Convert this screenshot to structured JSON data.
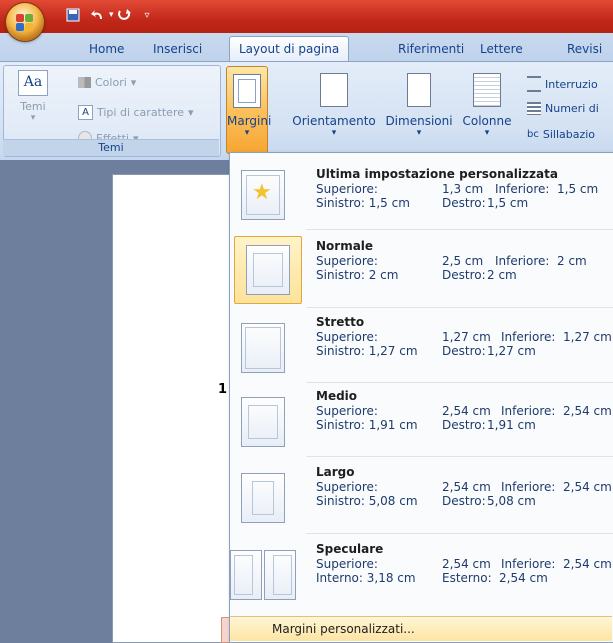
{
  "quick_access": {
    "save_icon": "save-icon",
    "undo_icon": "undo-icon",
    "redo_icon": "redo-icon",
    "customize_icon": "customize-icon"
  },
  "tabs": [
    {
      "label": "Home"
    },
    {
      "label": "Inserisci"
    },
    {
      "label": "Layout di pagina",
      "active": true
    },
    {
      "label": "Riferimenti"
    },
    {
      "label": "Lettere"
    },
    {
      "label": "Revisi"
    }
  ],
  "group_temi": {
    "temi_label": "Temi",
    "themes_button": "Temi",
    "colori": "Colori",
    "tipi_carattere": "Tipi di carattere",
    "effetti": "Effetti"
  },
  "ribbon_buttons": {
    "margini": "Margini",
    "orientamento": "Orientamento",
    "dimensioni": "Dimensioni",
    "colonne": "Colonne",
    "interruzioni": "Interruzio",
    "numeri": "Numeri di",
    "sillabazione": "Sillabazio"
  },
  "doc_fragment": "1",
  "margins_menu": {
    "items": [
      {
        "title": "Ultima impostazione personalizzata",
        "top_label": "Superiore:",
        "top": "1,3 cm",
        "bottom_label": "Inferiore:",
        "bottom": "1,5 cm",
        "left_label": "Sinistro: 1,5 cm",
        "right_label": "Destro:",
        "right": "1,5 cm"
      },
      {
        "title": "Normale",
        "top_label": "Superiore:",
        "top": "2,5 cm",
        "bottom_label": "Inferiore:",
        "bottom": "2 cm",
        "left_label": "Sinistro: 2 cm",
        "right_label": "Destro:",
        "right": "2 cm",
        "selected": true
      },
      {
        "title": "Stretto",
        "top_label": "Superiore:",
        "top": "1,27 cm",
        "bottom_label": "Inferiore:",
        "bottom": "1,27 cm",
        "left_label": "Sinistro: 1,27 cm",
        "right_label": "Destro:",
        "right": "1,27 cm"
      },
      {
        "title": "Medio",
        "top_label": "Superiore:",
        "top": "2,54 cm",
        "bottom_label": "Inferiore:",
        "bottom": "2,54 cm",
        "left_label": "Sinistro: 1,91 cm",
        "right_label": "Destro:",
        "right": "1,91 cm"
      },
      {
        "title": "Largo",
        "top_label": "Superiore:",
        "top": "2,54 cm",
        "bottom_label": "Inferiore:",
        "bottom": "2,54 cm",
        "left_label": "Sinistro: 5,08 cm",
        "right_label": "Destro:",
        "right": "5,08 cm"
      },
      {
        "title": "Speculare",
        "top_label": "Superiore:",
        "top": "2,54 cm",
        "bottom_label": "Inferiore:",
        "bottom": "2,54 cm",
        "left_label": "Interno: 3,18 cm",
        "right_label": "Esterno:",
        "right": "2,54 cm"
      }
    ],
    "custom_label": "Margini personalizzati..."
  },
  "colors": {
    "title_bar": "#c3281a",
    "highlight": "#fbc15e"
  }
}
